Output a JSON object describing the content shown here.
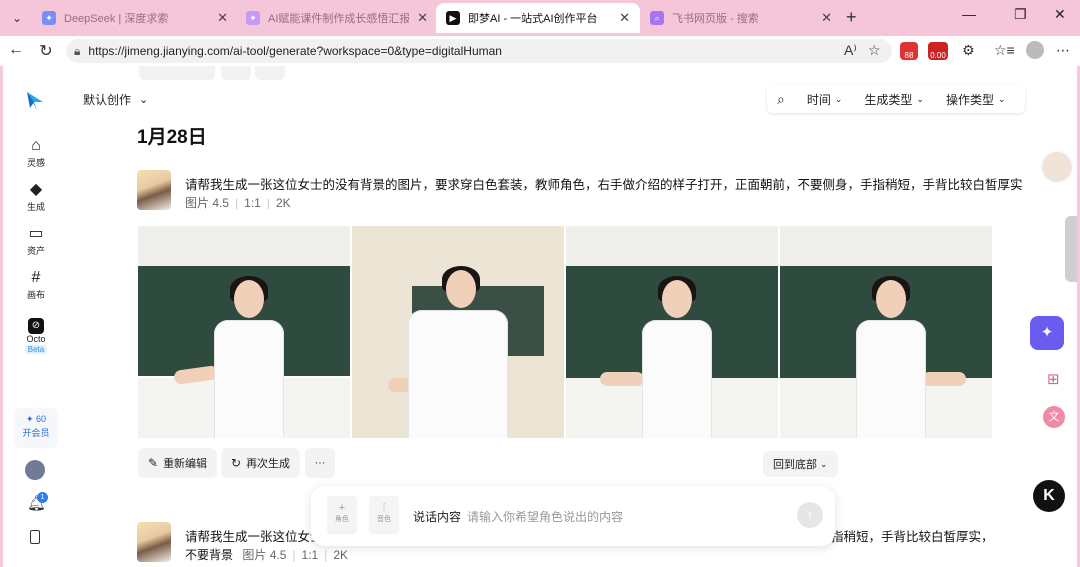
{
  "browser": {
    "tabs": [
      {
        "title": "DeepSeek | 深度求索",
        "active": false
      },
      {
        "title": "AI赋能课件制作成长感悟汇报 - De",
        "active": false
      },
      {
        "title": "即梦AI - 一站式AI创作平台",
        "active": true
      },
      {
        "title": "飞书网页版 - 搜索",
        "active": false
      }
    ],
    "url": "https://jimeng.jianying.com/ai-tool/generate?workspace=0&type=digitalHuman",
    "ext_badges": [
      "88",
      "0.00"
    ]
  },
  "sidebar": {
    "items": [
      {
        "label": "灵感",
        "icon": "home-icon"
      },
      {
        "label": "生成",
        "icon": "diamond-icon"
      },
      {
        "label": "资产",
        "icon": "folder-icon"
      },
      {
        "label": "画布",
        "icon": "canvas-icon"
      },
      {
        "label": "Octo",
        "icon": "octo-icon",
        "badge": "Beta"
      }
    ],
    "vip_points": "60",
    "vip_label": "开会员",
    "notif_count": "1"
  },
  "toolbar": {
    "workspace_label": "默认创作",
    "filters": [
      "时间",
      "生成类型",
      "操作类型"
    ]
  },
  "feed": {
    "date": "1月28日",
    "record1": {
      "prompt": "请帮我生成一张这位女士的没有背景的图片，要求穿白色套装，教师角色，右手做介绍的样子打开，正面朝前，不要侧身，手指稍短，手背比较白皙厚实",
      "model": "图片 4.5",
      "ratio": "1:1",
      "resolution": "2K"
    },
    "actions": {
      "edit": "重新编辑",
      "regen": "再次生成",
      "more": "···",
      "bottom": "回到底部"
    },
    "record2": {
      "prompt_left": "请帮我生成一张这位女士",
      "prompt_right": "指稍短，手背比较白皙厚实，",
      "prompt_line2": "不要背景",
      "model": "图片 4.5",
      "ratio": "1:1",
      "resolution": "2K"
    }
  },
  "chat": {
    "slot1": "角色",
    "slot2": "音色",
    "label": "说话内容",
    "placeholder": "请输入你希望角色说出的内容"
  },
  "colors": {
    "tabstrip": "#f5c6da",
    "accent": "#6b5cf0",
    "octo_badge": "#3a8fd6"
  }
}
